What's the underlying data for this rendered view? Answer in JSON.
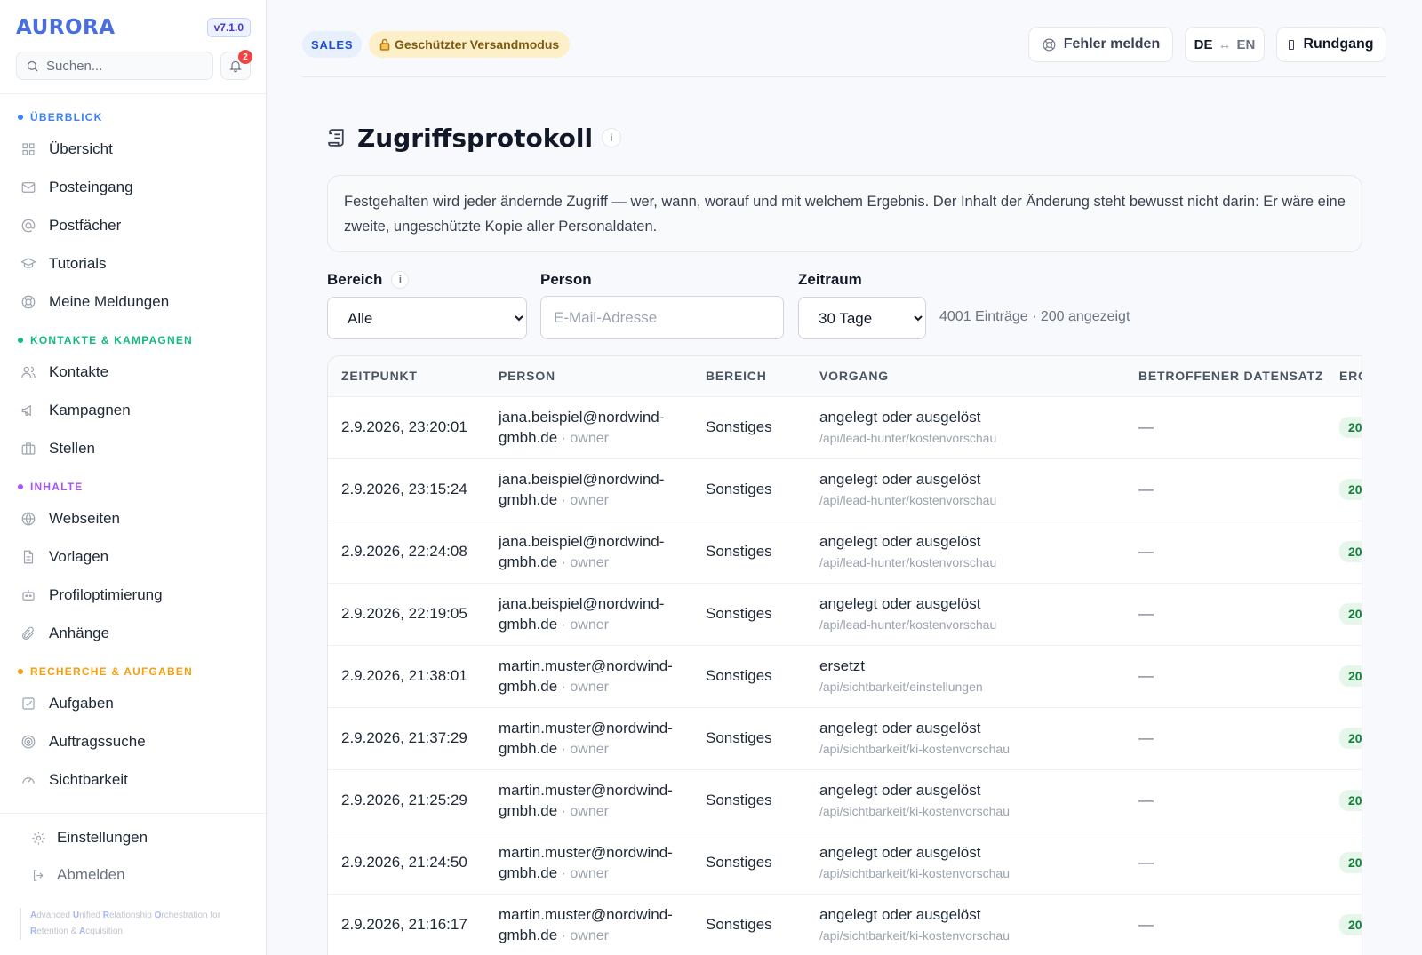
{
  "sidebar": {
    "brand": "AURORA",
    "version": "v7.1.0",
    "search_placeholder": "Suchen...",
    "notification_count": "2",
    "sections": [
      {
        "title": "ÜBERBLICK",
        "color": "#3b82f6",
        "items": [
          {
            "label": "Übersicht",
            "icon": "grid-icon"
          },
          {
            "label": "Posteingang",
            "icon": "mail-icon"
          },
          {
            "label": "Postfächer",
            "icon": "at-icon"
          },
          {
            "label": "Tutorials",
            "icon": "graduation-cap-icon"
          },
          {
            "label": "Meine Meldungen",
            "icon": "lifebuoy-icon"
          }
        ]
      },
      {
        "title": "KONTAKTE & KAMPAGNEN",
        "color": "#10b981",
        "items": [
          {
            "label": "Kontakte",
            "icon": "users-icon"
          },
          {
            "label": "Kampagnen",
            "icon": "megaphone-icon"
          },
          {
            "label": "Stellen",
            "icon": "briefcase-icon"
          }
        ]
      },
      {
        "title": "INHALTE",
        "color": "#a855f7",
        "items": [
          {
            "label": "Webseiten",
            "icon": "globe-icon"
          },
          {
            "label": "Vorlagen",
            "icon": "file-icon"
          },
          {
            "label": "Profiloptimierung",
            "icon": "robot-icon"
          },
          {
            "label": "Anhänge",
            "icon": "paperclip-icon"
          }
        ]
      },
      {
        "title": "RECHERCHE & AUFGABEN",
        "color": "#f59e0b",
        "items": [
          {
            "label": "Aufgaben",
            "icon": "checkbox-icon"
          },
          {
            "label": "Auftragssuche",
            "icon": "target-icon"
          },
          {
            "label": "Sichtbarkeit",
            "icon": "gauge-icon"
          }
        ]
      }
    ],
    "settings_label": "Einstellungen",
    "logout_label": "Abmelden",
    "tagline": [
      "A",
      "dvanced ",
      "U",
      "nified ",
      "R",
      "elationship ",
      "O",
      "rchestration for ",
      "R",
      "etention & ",
      "A",
      "cquisition"
    ]
  },
  "topbar": {
    "sales_badge": "SALES",
    "safe_mode_badge": "Geschützter Versandmodus",
    "report_button": "Fehler melden",
    "lang_left": "DE",
    "lang_arrow": "↔",
    "lang_right": "EN",
    "tour_button": "Rundgang"
  },
  "page": {
    "title": "Zugriffsprotokoll",
    "info": "i",
    "intro": "Festgehalten wird jeder ändernde Zugriff — wer, wann, worauf und mit welchem Ergebnis. Der Inhalt der Änderung steht bewusst nicht darin: Er wäre eine zweite, ungeschützte Kopie aller Personaldaten."
  },
  "filters": {
    "area_label": "Bereich",
    "area_value": "Alle",
    "person_label": "Person",
    "person_placeholder": "E-Mail-Adresse",
    "period_label": "Zeitraum",
    "period_value": "30 Tage",
    "count_text": "4001 Einträge · 200 angezeigt"
  },
  "table": {
    "columns": [
      "ZEITPUNKT",
      "PERSON",
      "BEREICH",
      "VORGANG",
      "BETROFFENER DATENSATZ",
      "ERGEBNIS"
    ],
    "rows": [
      {
        "time": "2.9.2026, 23:20:01",
        "email_a": "jana.beispiel@nordwind-",
        "email_b": "gmbh.de",
        "role": "owner",
        "area": "Sonstiges",
        "op": "angelegt oder ausgelöst",
        "path": "/api/lead-hunter/kostenvorschau",
        "record": "—",
        "result": "20"
      },
      {
        "time": "2.9.2026, 23:15:24",
        "email_a": "jana.beispiel@nordwind-",
        "email_b": "gmbh.de",
        "role": "owner",
        "area": "Sonstiges",
        "op": "angelegt oder ausgelöst",
        "path": "/api/lead-hunter/kostenvorschau",
        "record": "—",
        "result": "20"
      },
      {
        "time": "2.9.2026, 22:24:08",
        "email_a": "jana.beispiel@nordwind-",
        "email_b": "gmbh.de",
        "role": "owner",
        "area": "Sonstiges",
        "op": "angelegt oder ausgelöst",
        "path": "/api/lead-hunter/kostenvorschau",
        "record": "—",
        "result": "20"
      },
      {
        "time": "2.9.2026, 22:19:05",
        "email_a": "jana.beispiel@nordwind-",
        "email_b": "gmbh.de",
        "role": "owner",
        "area": "Sonstiges",
        "op": "angelegt oder ausgelöst",
        "path": "/api/lead-hunter/kostenvorschau",
        "record": "—",
        "result": "20"
      },
      {
        "time": "2.9.2026, 21:38:01",
        "email_a": "martin.muster@nordwind-",
        "email_b": "gmbh.de",
        "role": "owner",
        "area": "Sonstiges",
        "op": "ersetzt",
        "path": "/api/sichtbarkeit/einstellungen",
        "record": "—",
        "result": "20"
      },
      {
        "time": "2.9.2026, 21:37:29",
        "email_a": "martin.muster@nordwind-",
        "email_b": "gmbh.de",
        "role": "owner",
        "area": "Sonstiges",
        "op": "angelegt oder ausgelöst",
        "path": "/api/sichtbarkeit/ki-kostenvorschau",
        "record": "—",
        "result": "20"
      },
      {
        "time": "2.9.2026, 21:25:29",
        "email_a": "martin.muster@nordwind-",
        "email_b": "gmbh.de",
        "role": "owner",
        "area": "Sonstiges",
        "op": "angelegt oder ausgelöst",
        "path": "/api/sichtbarkeit/ki-kostenvorschau",
        "record": "—",
        "result": "20"
      },
      {
        "time": "2.9.2026, 21:24:50",
        "email_a": "martin.muster@nordwind-",
        "email_b": "gmbh.de",
        "role": "owner",
        "area": "Sonstiges",
        "op": "angelegt oder ausgelöst",
        "path": "/api/sichtbarkeit/ki-kostenvorschau",
        "record": "—",
        "result": "20"
      },
      {
        "time": "2.9.2026, 21:16:17",
        "email_a": "martin.muster@nordwind-",
        "email_b": "gmbh.de",
        "role": "owner",
        "area": "Sonstiges",
        "op": "angelegt oder ausgelöst",
        "path": "/api/sichtbarkeit/ki-kostenvorschau",
        "record": "—",
        "result": "20"
      }
    ]
  }
}
